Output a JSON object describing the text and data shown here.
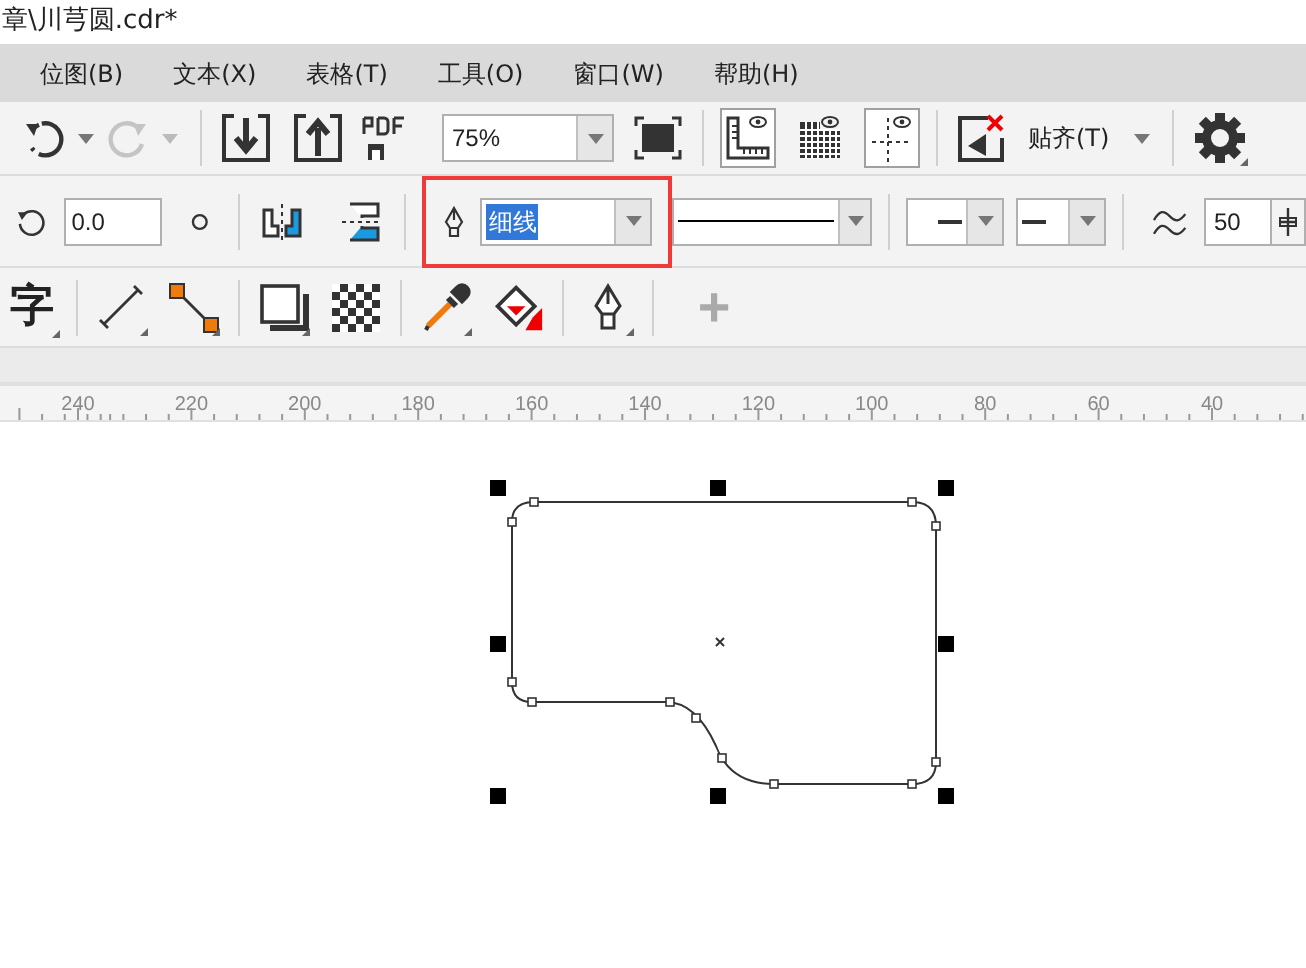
{
  "window": {
    "title": "章\\川芎圆.cdr*"
  },
  "menu": [
    "位图(B)",
    "文本(X)",
    "表格(T)",
    "工具(O)",
    "窗口(W)",
    "帮助(H)"
  ],
  "standard_toolbar": {
    "zoom": "75%",
    "snap": "贴齐(T)",
    "rulers_on": true,
    "grid_on": false,
    "guides_on": true
  },
  "property_bar": {
    "angle": "0.0",
    "outline_width": "细线",
    "outline_width_selected": true,
    "highlighted": true,
    "smoothing": "50"
  },
  "toolbox": {
    "text_tool": "字",
    "add": "+"
  },
  "ruler": [
    "240",
    "220",
    "200",
    "180",
    "160",
    "140",
    "120",
    "100",
    "80",
    "60",
    "40"
  ]
}
